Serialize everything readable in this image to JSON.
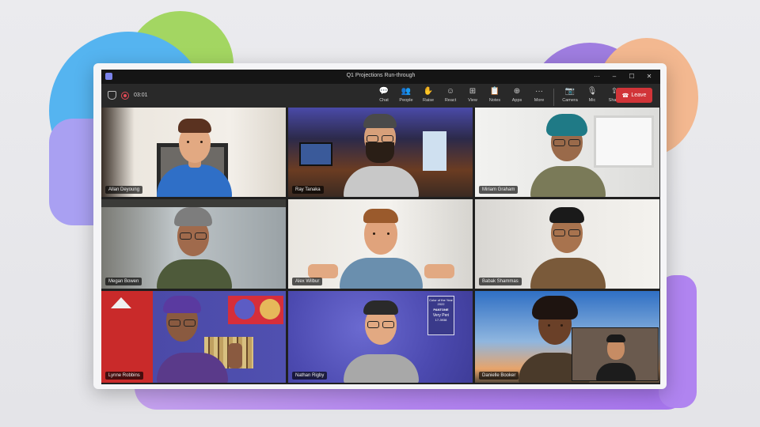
{
  "meeting": {
    "title": "Q1 Projections Run-through",
    "elapsed": "03:01"
  },
  "window_controls": {
    "more": "···",
    "minimize": "–",
    "maximize": "☐",
    "close": "✕"
  },
  "toolbar": {
    "items": [
      {
        "label": "Chat",
        "icon": "chat-icon"
      },
      {
        "label": "People",
        "icon": "people-icon"
      },
      {
        "label": "Raise",
        "icon": "hand-icon"
      },
      {
        "label": "React",
        "icon": "smiley-icon"
      },
      {
        "label": "View",
        "icon": "grid-icon"
      },
      {
        "label": "Notes",
        "icon": "notes-icon"
      },
      {
        "label": "Apps",
        "icon": "apps-icon"
      },
      {
        "label": "More",
        "icon": "more-icon"
      }
    ],
    "media": [
      {
        "label": "Camera",
        "icon": "camera-off-icon"
      },
      {
        "label": "Mic",
        "icon": "mic-icon"
      },
      {
        "label": "Share",
        "icon": "share-icon"
      }
    ],
    "leave_label": "Leave"
  },
  "participants": [
    {
      "name": "Allan Deyoung"
    },
    {
      "name": "Ray Tanaka"
    },
    {
      "name": "Miriam Graham"
    },
    {
      "name": "Megan Bowen"
    },
    {
      "name": "Alex Wilbur"
    },
    {
      "name": "Babak Shammas"
    },
    {
      "name": "Lynne Robbins"
    },
    {
      "name": "Nathan Rigby"
    },
    {
      "name": "Danielle Booker"
    }
  ],
  "poster": {
    "line1": "Color of the Year 2022",
    "brand": "PANTONE",
    "line2": "Very Peri",
    "code": "17-3938"
  },
  "colors": {
    "leave": "#d13438",
    "app_bg": "#202020",
    "active_tile_border": "#7b83eb"
  }
}
